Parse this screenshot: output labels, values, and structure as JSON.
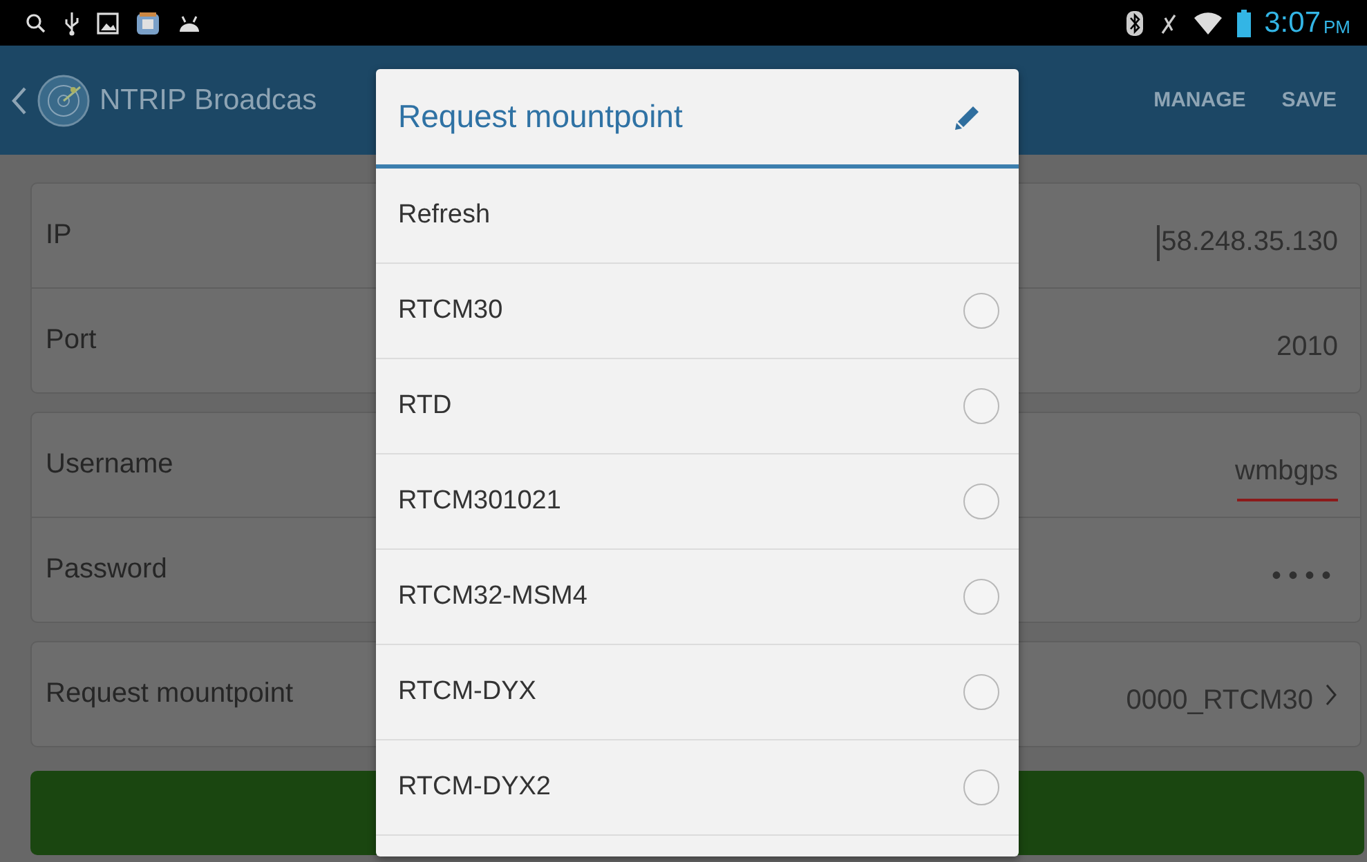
{
  "status_bar": {
    "time": "3:07",
    "ampm": "PM"
  },
  "app_bar": {
    "title": "NTRIP Broadcas",
    "actions": [
      "MANAGE",
      "SAVE"
    ]
  },
  "groups": [
    {
      "rows": [
        {
          "label": "IP",
          "value": "58.248.35.130",
          "kind": "text",
          "focused": true,
          "misspelled": false
        },
        {
          "label": "Port",
          "value": "2010",
          "kind": "text",
          "focused": false,
          "misspelled": false
        }
      ]
    },
    {
      "rows": [
        {
          "label": "Username",
          "value": "wmbgps",
          "kind": "text",
          "focused": false,
          "misspelled": true
        },
        {
          "label": "Password",
          "value": "••••",
          "kind": "password",
          "focused": false,
          "misspelled": false
        }
      ]
    },
    {
      "rows": [
        {
          "label": "Request mountpoint",
          "value": "0000_RTCM30",
          "kind": "link"
        }
      ]
    }
  ],
  "dialog": {
    "title": "Request mountpoint",
    "items": [
      {
        "label": "Refresh",
        "kind": "action"
      },
      {
        "label": "RTCM30",
        "kind": "option",
        "selected": false
      },
      {
        "label": "RTD",
        "kind": "option",
        "selected": false
      },
      {
        "label": "RTCM301021",
        "kind": "option",
        "selected": false
      },
      {
        "label": "RTCM32-MSM4",
        "kind": "option",
        "selected": false
      },
      {
        "label": "RTCM-DYX",
        "kind": "option",
        "selected": false
      },
      {
        "label": "RTCM-DYX2",
        "kind": "option",
        "selected": false
      }
    ]
  }
}
